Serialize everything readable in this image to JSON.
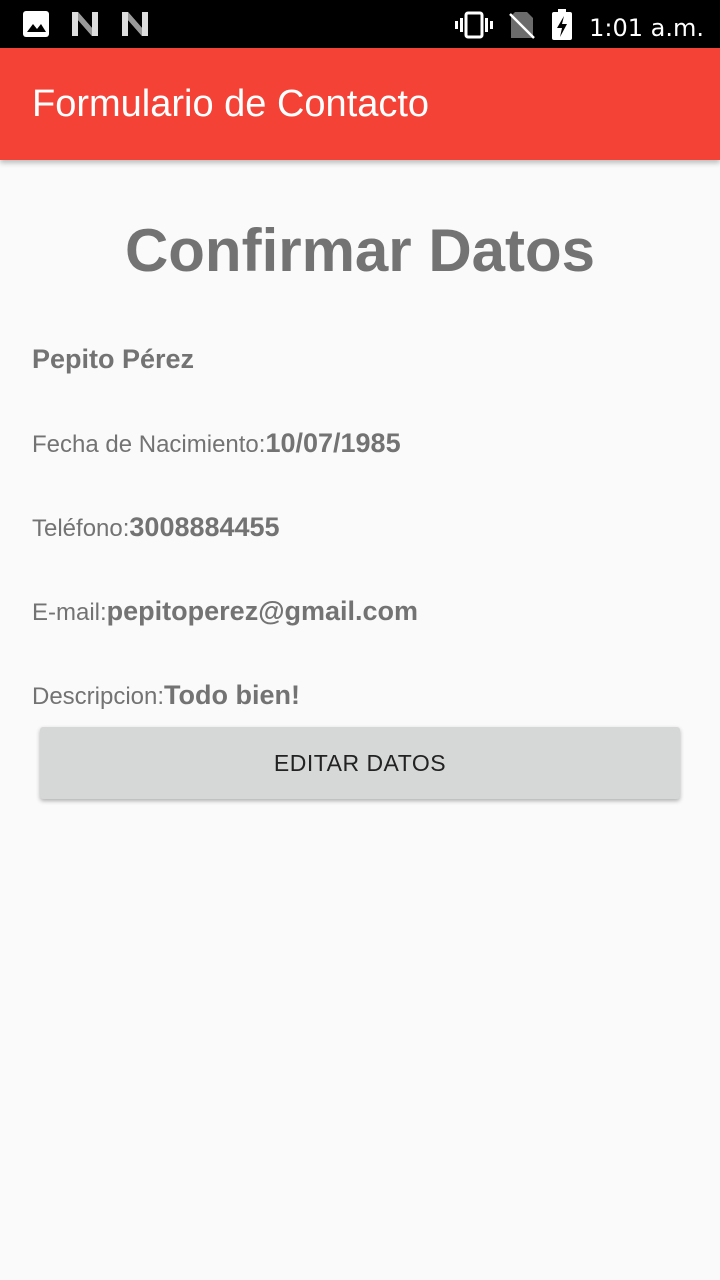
{
  "status_bar": {
    "icons_left": [
      "image-icon",
      "n-notification-icon",
      "n-notification-icon"
    ],
    "icons_right": [
      "vibrate-icon",
      "no-sim-icon",
      "battery-charging-icon"
    ],
    "time": "1:01 a.m."
  },
  "app_bar": {
    "title": "Formulario de Contacto",
    "color": "#f44336"
  },
  "main": {
    "title": "Confirmar Datos",
    "name": "Pepito Pérez",
    "fields": [
      {
        "label": "Fecha de Nacimiento:",
        "value": "10/07/1985"
      },
      {
        "label": "Teléfono:",
        "value": "3008884455"
      },
      {
        "label": "E-mail:",
        "value": "pepitoperez@gmail.com"
      },
      {
        "label": "Descripcion:",
        "value": "Todo bien!"
      }
    ],
    "edit_button": "EDITAR DATOS"
  }
}
